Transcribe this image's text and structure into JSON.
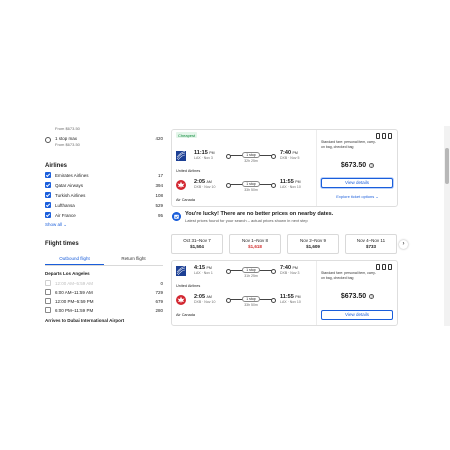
{
  "sidebar": {
    "stops": [
      {
        "label": "",
        "sub": "From $673.50",
        "count": ""
      },
      {
        "label": "1 stop max",
        "sub": "From $673.50",
        "count": "420"
      }
    ],
    "airlines_title": "Airlines",
    "airlines": [
      {
        "name": "Emirates Airlines",
        "count": "17"
      },
      {
        "name": "Qatar Airways",
        "count": "394"
      },
      {
        "name": "Turkish Airlines",
        "count": "108"
      },
      {
        "name": "Lufthansa",
        "count": "529"
      },
      {
        "name": "Air France",
        "count": "95"
      }
    ],
    "show_all": "Show all",
    "flight_times_title": "Flight times",
    "tabs": [
      "Outbound flight",
      "Return flight"
    ],
    "departs_label": "Departs Los Angeles",
    "times": [
      {
        "label": "12:00 AM–5:59 AM",
        "count": "0",
        "disabled": true
      },
      {
        "label": "6:00 AM–11:59 AM",
        "count": "729",
        "disabled": false
      },
      {
        "label": "12:00 PM–5:59 PM",
        "count": "679",
        "disabled": false
      },
      {
        "label": "6:00 PM–11:59 PM",
        "count": "280",
        "disabled": false
      }
    ],
    "arrives_label": "Arrives to Dubai International Airport"
  },
  "results": [
    {
      "badge": "Cheapest",
      "legs": [
        {
          "dep_time": "11:15",
          "dep_ampm": "PM",
          "dep_info": "LAX · Nov 3",
          "stops": "1 stop",
          "duration": "32h 25m",
          "arr_time": "7:40",
          "arr_ampm": "PM",
          "arr_info": "DXB · Nov 5"
        },
        {
          "dep_time": "2:05",
          "dep_ampm": "AM",
          "dep_info": "DXB · Nov 10",
          "stops": "1 stop",
          "duration": "33h 50m",
          "arr_time": "11:55",
          "arr_ampm": "PM",
          "arr_info": "LAX · Nov 10"
        }
      ],
      "carriers": [
        "United Airlines",
        "Air Canada"
      ],
      "fare_note": "Standard fare: personal item, carry-on bag, checked bag",
      "price": "$673.50",
      "button": "View details",
      "explore": "Explore ticket options"
    },
    {
      "legs": [
        {
          "dep_time": "4:15",
          "dep_ampm": "PM",
          "dep_info": "LAX · Nov 1",
          "stops": "1 stop",
          "duration": "31h 25m",
          "arr_time": "7:40",
          "arr_ampm": "PM",
          "arr_info": "DXB · Nov 3"
        },
        {
          "dep_time": "2:05",
          "dep_ampm": "AM",
          "dep_info": "DXB · Nov 10",
          "stops": "1 stop",
          "duration": "33h 50m",
          "arr_time": "11:55",
          "arr_ampm": "PM",
          "arr_info": "LAX · Nov 10"
        }
      ],
      "carriers": [
        "United Airlines",
        "Air Canada"
      ],
      "fare_note": "Standard fare: personal item, carry-on bag, checked bag",
      "price": "$673.50",
      "button": "View details"
    }
  ],
  "lucky": {
    "title": "You're lucky! There are no better prices on nearby dates.",
    "sub": "Latest prices found for your search – actual prices shown in next step"
  },
  "date_tiles": [
    {
      "dates": "Oct 31–Nov 7",
      "price": "$1,504",
      "highlight": false
    },
    {
      "dates": "Nov 1–Nov 8",
      "price": "$1,618",
      "highlight": true
    },
    {
      "dates": "Nov 2–Nov 9",
      "price": "$1,609",
      "highlight": false
    },
    {
      "dates": "Nov 4–Nov 11",
      "price": "$733",
      "highlight": false
    }
  ],
  "colors": {
    "accent": "#1a5edb",
    "united": "#1c3f94",
    "air_canada": "#d22630",
    "price_up": "#d12d2d"
  },
  "icons": {
    "next": "›",
    "chevron": "⌄",
    "info": "?"
  }
}
